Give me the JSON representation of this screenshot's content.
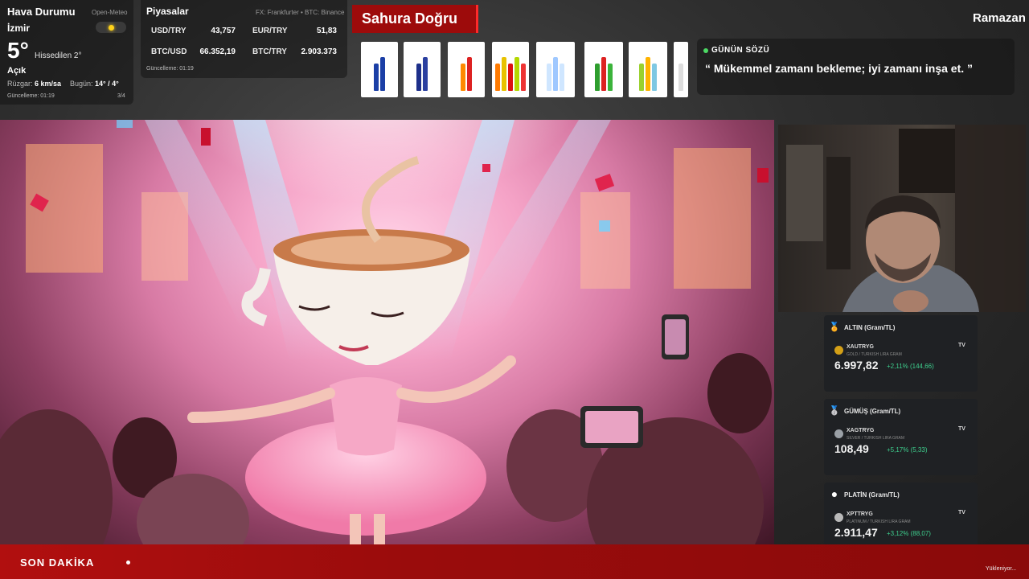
{
  "weather": {
    "title": "Hava Durumu",
    "source": "Open-Meteo",
    "city": "İzmir",
    "icon": "sun-icon",
    "temperature": "5°",
    "feels_like": "Hissedilen 2°",
    "condition": "Açık",
    "wind_label": "Rüzgar:",
    "wind_value": "6 km/sa",
    "today_label": "Bugün:",
    "today_value": "14° / 4°",
    "updated": "Güncelleme: 01:19",
    "page": "3/4"
  },
  "markets": {
    "title": "Piyasalar",
    "source": "FX: Frankfurter • BTC: Binance",
    "rates": [
      {
        "label": "USD/TRY",
        "value": "43,757"
      },
      {
        "label": "EUR/TRY",
        "value": "51,83"
      },
      {
        "label": "BTC/USD",
        "value": "66.352,19"
      },
      {
        "label": "BTC/TRY",
        "value": "2.903.373"
      }
    ],
    "updated": "Güncelleme: 01:19"
  },
  "sahur": {
    "title": "Sahura Doğru"
  },
  "products": [
    {
      "name": "product-blue-cans",
      "colors": [
        "#1b3fa6",
        "#1b3fa6"
      ]
    },
    {
      "name": "product-blue-bottles",
      "colors": [
        "#1d2f8a",
        "#2a3fa0"
      ]
    },
    {
      "name": "product-orange-bottles",
      "colors": [
        "#ff8a00",
        "#d22"
      ]
    },
    {
      "name": "product-soda-set",
      "colors": [
        "#ff7a00",
        "#e8c200",
        "#d11",
        "#b4d800",
        "#e33"
      ]
    },
    {
      "name": "product-water-bottles",
      "colors": [
        "#cfe6ff",
        "#9fc8ff",
        "#cfe6ff"
      ]
    },
    {
      "name": "product-green-bottles",
      "colors": [
        "#2e9e2e",
        "#d22",
        "#3bb33b"
      ]
    },
    {
      "name": "product-fruit-bottles",
      "colors": [
        "#9ad12f",
        "#ffb300",
        "#7ec8e3"
      ]
    },
    {
      "name": "product-partial",
      "colors": [
        "#ddd"
      ]
    }
  ],
  "quote": {
    "label": "GÜNÜN SÖZÜ",
    "text": "“ Mükemmel zamanı bekleme; iyi zamanı inşa et. ”"
  },
  "header": {
    "ramazan": "Ramazan"
  },
  "metals": [
    {
      "name": "ALTIN (Gram/TL)",
      "icon": "medal-icon",
      "symbol": "XAUTRYG",
      "description": "GOLD / TURKISH LIRA GRAM",
      "price": "6.997,82",
      "change": "+2,11% (144,66)",
      "coin_color": "#d4a017"
    },
    {
      "name": "GÜMÜŞ (Gram/TL)",
      "icon": "silver-medal-icon",
      "symbol": "XAGTRYG",
      "description": "SILVER / TURKISH LIRA GRAM",
      "price": "108,49",
      "change": "+5,17% (5,33)",
      "coin_color": "#9aa0a6"
    },
    {
      "name": "PLATİN (Gram/TL)",
      "icon": "white-circle-icon",
      "symbol": "XPTTRYG",
      "description": "PLATINUM / TURKISH LIRA GRAM",
      "price": "2.911,47",
      "change": "+3,12% (88,07)",
      "coin_color": "#b9b9b9"
    }
  ],
  "ticker": {
    "label": "SON DAKİKA",
    "loading": "Yükleniyor..."
  },
  "colors": {
    "accent_red": "#9d0b0b",
    "positive_green": "#3ecf8e",
    "quote_dot": "#4cd964"
  }
}
